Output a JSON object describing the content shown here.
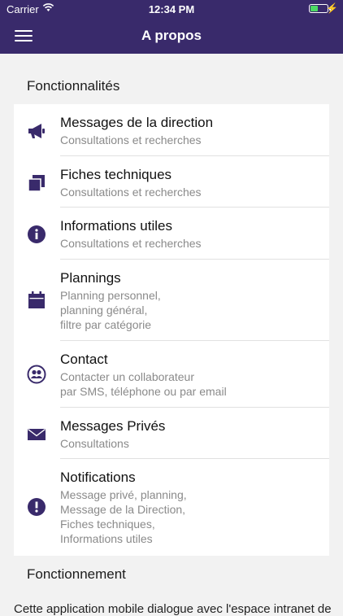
{
  "status": {
    "carrier": "Carrier",
    "time": "12:34 PM",
    "battery_level": 0.5
  },
  "nav": {
    "title": "A propos",
    "menu_icon": "hamburger-menu-icon"
  },
  "colors": {
    "brand": "#392a6b",
    "battery": "#4cd964",
    "subtitle": "#8a8a8a"
  },
  "sections": {
    "features_title": "Fonctionnalités",
    "operation_title": "Fonctionnement"
  },
  "features": [
    {
      "icon": "megaphone-icon",
      "title": "Messages de la direction",
      "subtitle": "Consultations et recherches"
    },
    {
      "icon": "documents-icon",
      "title": "Fiches techniques",
      "subtitle": "Consultations et recherches"
    },
    {
      "icon": "info-icon",
      "title": "Informations utiles",
      "subtitle": "Consultations et recherches"
    },
    {
      "icon": "calendar-icon",
      "title": "Plannings",
      "subtitle": "Planning personnel,\nplanning général,\nfiltre par catégorie"
    },
    {
      "icon": "contacts-icon",
      "title": "Contact",
      "subtitle": "Contacter un collaborateur\npar SMS, téléphone ou par email"
    },
    {
      "icon": "envelope-icon",
      "title": "Messages Privés",
      "subtitle": "Consultations"
    },
    {
      "icon": "alert-icon",
      "title": "Notifications",
      "subtitle": "Message privé, planning,\nMessage de la Direction,\nFiches techniques,\nInformations utiles"
    }
  ],
  "operation_text": "Cette application mobile dialogue avec l'espace intranet de"
}
